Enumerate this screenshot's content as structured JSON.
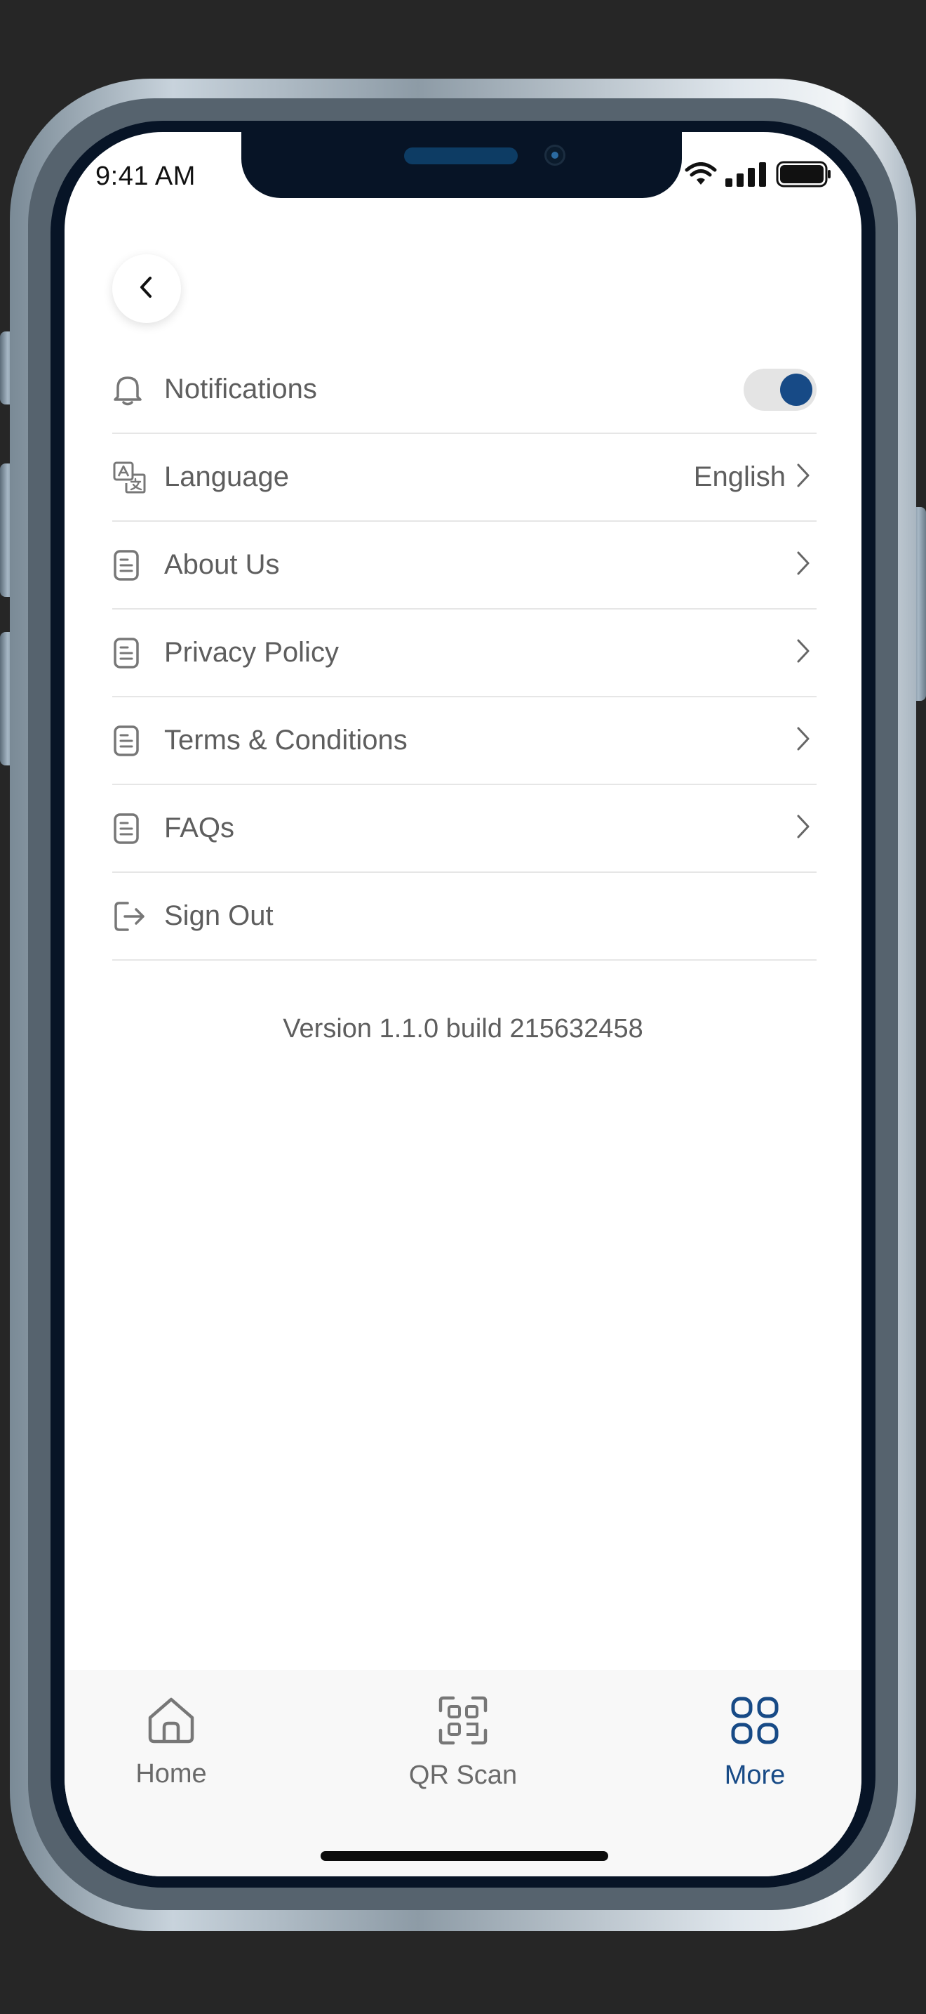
{
  "status_bar": {
    "time": "9:41 AM"
  },
  "settings": {
    "notifications": {
      "label": "Notifications",
      "enabled": true
    },
    "language": {
      "label": "Language",
      "value": "English"
    },
    "about": {
      "label": "About Us"
    },
    "privacy": {
      "label": "Privacy Policy"
    },
    "terms": {
      "label": "Terms & Conditions"
    },
    "faqs": {
      "label": "FAQs"
    },
    "sign_out": {
      "label": "Sign Out"
    }
  },
  "version_text": "Version 1.1.0 build 215632458",
  "bottom_nav": {
    "home": {
      "label": "Home"
    },
    "qr_scan": {
      "label": "QR Scan"
    },
    "more": {
      "label": "More",
      "active": true
    }
  },
  "colors": {
    "accent": "#174a86",
    "text": "#5e5e5e",
    "divider": "#e6e6e6",
    "bezel": "#071426"
  },
  "icons": {
    "back": "chevron-left-icon",
    "notifications": "bell-icon",
    "language": "translate-icon",
    "document": "document-icon",
    "sign_out": "sign-out-icon",
    "home": "home-icon",
    "qr": "qr-scan-icon",
    "more": "grid-icon"
  }
}
